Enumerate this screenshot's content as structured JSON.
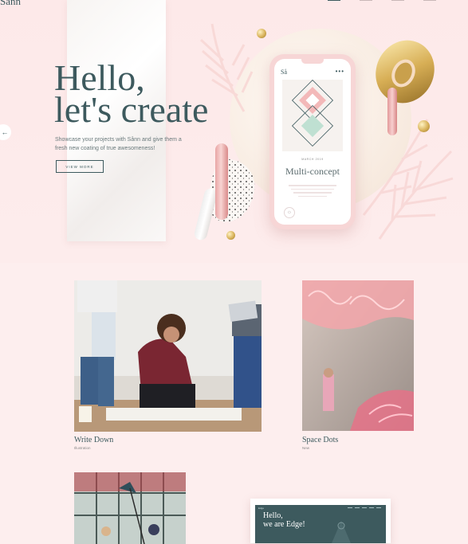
{
  "brand": {
    "logo": "Sånn"
  },
  "hero": {
    "title": "Hello,\nlet's create",
    "subtitle": "Showcase your projects with Sånn and give them a fresh new coating of true awesomeness!",
    "cta": "VIEW MORE",
    "prev_icon": "arrow-left-icon",
    "phone": {
      "logo": "Så",
      "menu": "•••",
      "date": "MARCH 2019",
      "heading": "Multi-concept"
    }
  },
  "portfolio": [
    {
      "title": "Write Down",
      "category": "Illustration"
    },
    {
      "title": "Space Dots",
      "category": "New"
    },
    {
      "title": "",
      "category": ""
    },
    {
      "title": "Hello,\nwe are Edge!",
      "category": ""
    }
  ],
  "colors": {
    "accent": "#3d5a5e",
    "background": "#fdeeee",
    "pink": "#f7d6d6",
    "gold": "#d8b25a"
  }
}
